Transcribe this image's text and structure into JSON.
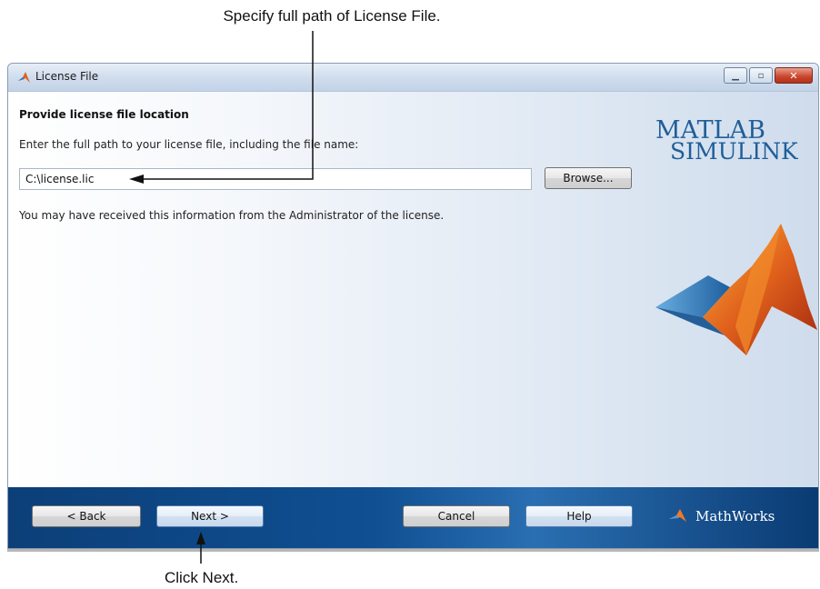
{
  "annotations": {
    "top": "Specify full path of License File.",
    "bottom": "Click Next."
  },
  "window": {
    "title": "License File",
    "controls": [
      "minimize-icon",
      "maximize-icon",
      "close-icon"
    ]
  },
  "content": {
    "heading": "Provide license file location",
    "instruction": "Enter the full path to your license file, including the file name:",
    "path_value": "C:\\license.lic",
    "browse_label": "Browse...",
    "note": "You may have received this information from the Administrator of the license."
  },
  "logo": {
    "line1": "MATLAB",
    "line2": "SIMULINK",
    "mathworks": "MathWorks"
  },
  "footer": {
    "back_label": "< Back",
    "next_label": "Next >",
    "cancel_label": "Cancel",
    "help_label": "Help"
  },
  "colors": {
    "footer_blue": "#0f4f92",
    "logo_blue": "#1f5e99",
    "membrane_orange": "#e0601c"
  }
}
